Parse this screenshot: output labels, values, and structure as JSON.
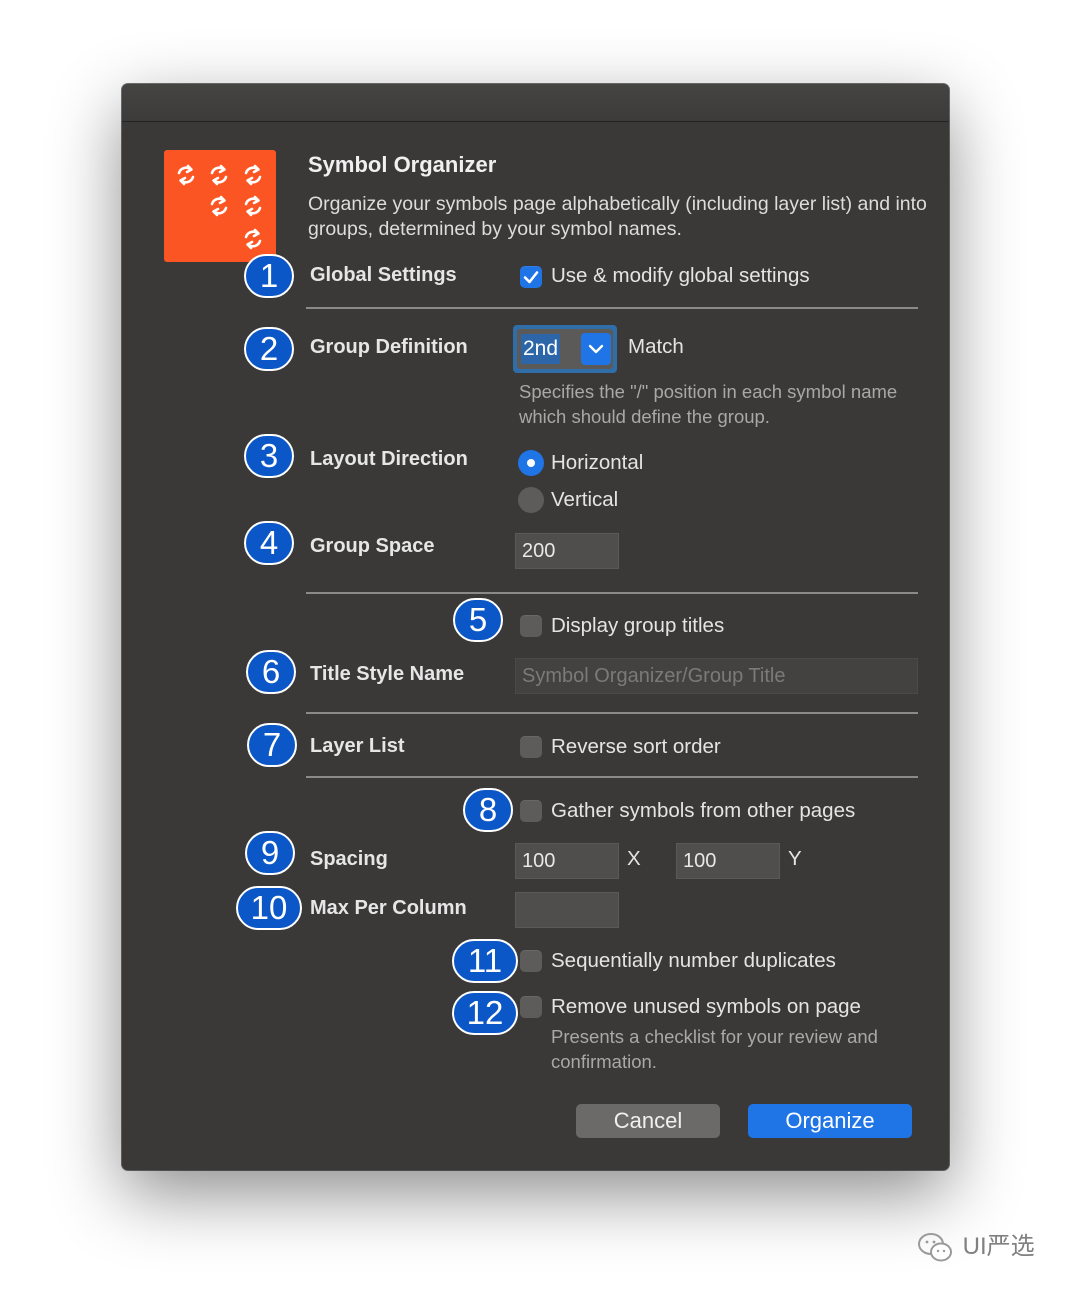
{
  "dialog": {
    "app_title": "Symbol Organizer",
    "app_description": "Organize your symbols page alphabetically (including layer list) and into groups, determined by your symbol names.",
    "icon_name": "refresh-arrows-icon",
    "accent_color": "#1f74e6",
    "icon_color": "#fc5524"
  },
  "settings": {
    "global_settings_label": "Global Settings",
    "use_global_label": "Use & modify global settings",
    "use_global_checked": true,
    "group_definition_label": "Group Definition",
    "group_definition_value": "2nd",
    "group_definition_suffix": "Match",
    "group_definition_hint": "Specifies the \"/\" position in each symbol name which should define the group.",
    "layout_direction_label": "Layout Direction",
    "layout_options": [
      "Horizontal",
      "Vertical"
    ],
    "layout_selected": "Horizontal",
    "group_space_label": "Group Space",
    "group_space_value": "200",
    "display_titles_label": "Display group titles",
    "display_titles_checked": false,
    "title_style_label": "Title Style Name",
    "title_style_placeholder": "Symbol Organizer/Group Title",
    "layer_list_label": "Layer List",
    "reverse_sort_label": "Reverse sort order",
    "reverse_sort_checked": false,
    "gather_label": "Gather symbols from other pages",
    "gather_checked": false,
    "spacing_label": "Spacing",
    "spacing_x_value": "100",
    "spacing_x_suffix": "X",
    "spacing_y_value": "100",
    "spacing_y_suffix": "Y",
    "max_per_column_label": "Max Per Column",
    "max_per_column_value": "",
    "sequential_label": "Sequentially number duplicates",
    "sequential_checked": false,
    "remove_unused_label": "Remove unused symbols on page",
    "remove_unused_checked": false,
    "remove_unused_hint": "Presents a checklist for your review and confirmation."
  },
  "buttons": {
    "cancel_label": "Cancel",
    "organize_label": "Organize"
  },
  "badges": [
    "1",
    "2",
    "3",
    "4",
    "5",
    "6",
    "7",
    "8",
    "9",
    "10",
    "11",
    "12"
  ],
  "watermark": {
    "text": "UI严选",
    "icon_name": "wechat-icon"
  }
}
